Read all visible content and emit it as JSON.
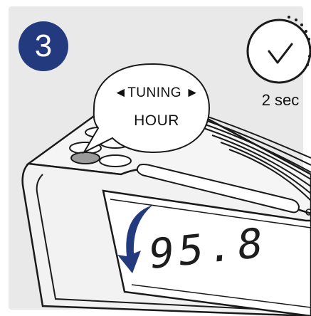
{
  "step": {
    "number": "3"
  },
  "timer": {
    "duration": "2 sec",
    "icon": "stopwatch-icon"
  },
  "callout": {
    "line1": "◄TUNING ►",
    "line2": "HOUR"
  },
  "display": {
    "frequency": "95.8"
  },
  "colors": {
    "badge": "#243a7f",
    "arrow": "#243a7f",
    "panel": "#e9e9ea",
    "device_line": "#1a1a1a",
    "button_highlight": "#9a9a9a"
  }
}
